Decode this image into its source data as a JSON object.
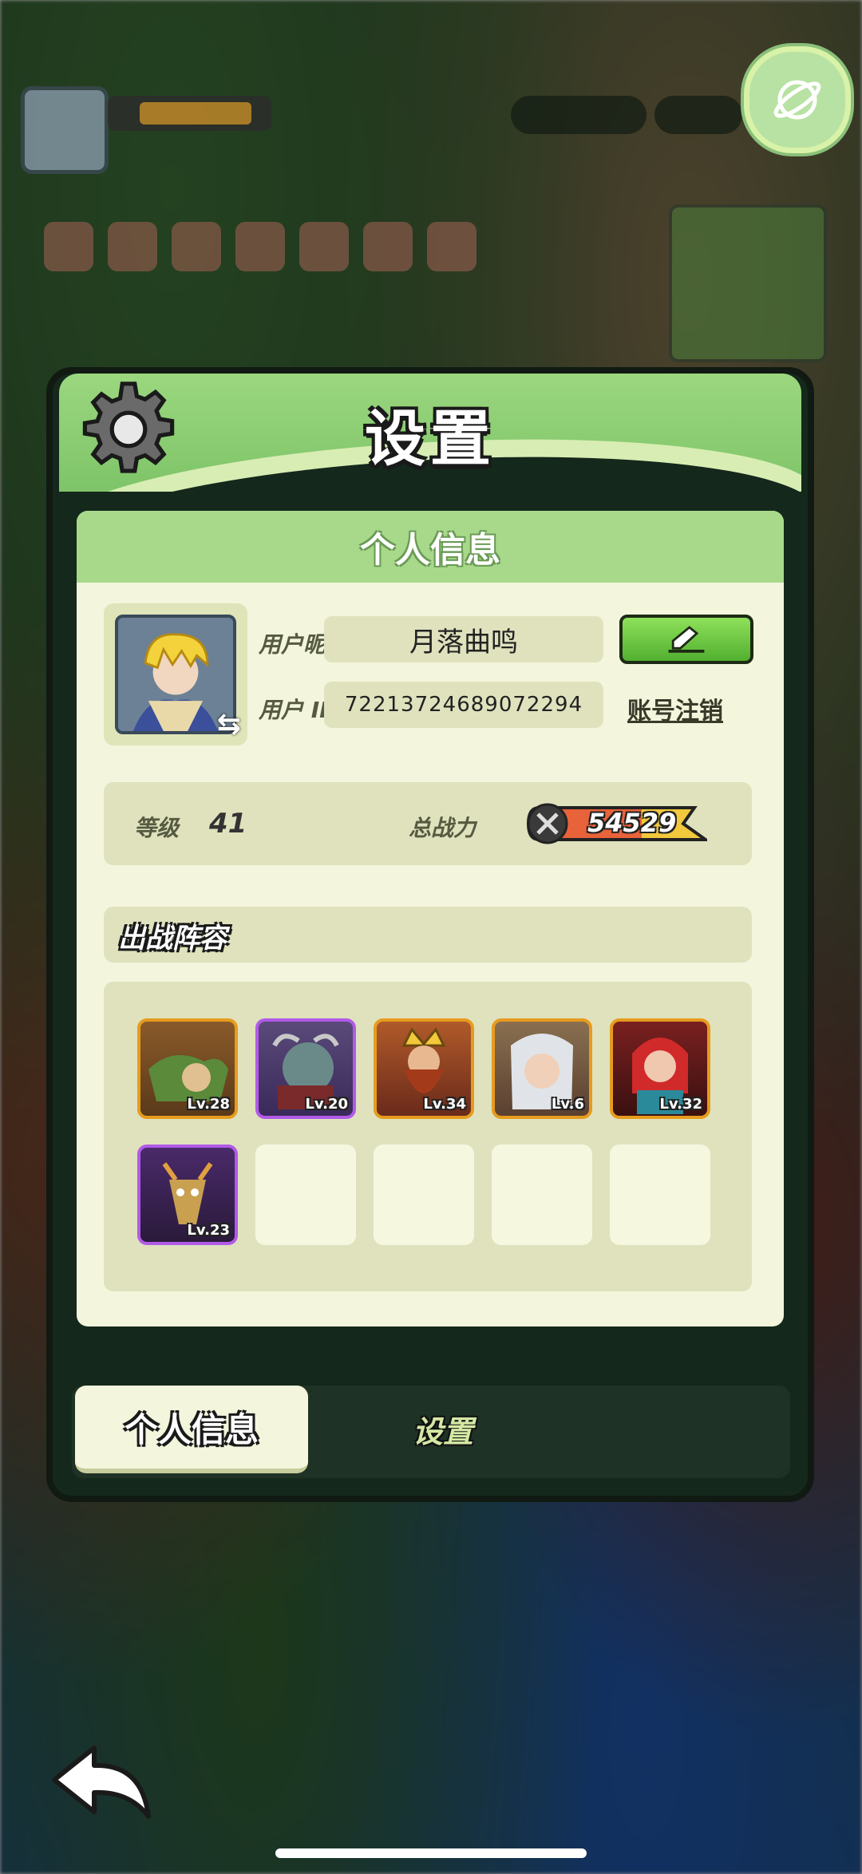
{
  "window": {
    "title": "设置"
  },
  "panel": {
    "header": "个人信息"
  },
  "profile": {
    "nickname_label": "用户昵称",
    "nickname": "月落曲鸣",
    "id_label": "用户 ID",
    "user_id": "72213724689072294",
    "delete_account_link": "账号注销",
    "edit_icon": "pencil-icon",
    "swap_icon": "swap-icon"
  },
  "stats": {
    "level_label": "等级",
    "level": "41",
    "power_label": "总战力",
    "power": "54529"
  },
  "lineup": {
    "title": "出战阵容",
    "heroes": [
      {
        "name": "crocodile-hero",
        "level": "Lv.28",
        "rarity": "gold"
      },
      {
        "name": "beast-warrior-hero",
        "level": "Lv.20",
        "rarity": "purple"
      },
      {
        "name": "king-dwarf-hero",
        "level": "Lv.34",
        "rarity": "gold"
      },
      {
        "name": "white-hair-hero",
        "level": "Lv.6",
        "rarity": "gold"
      },
      {
        "name": "red-hair-hero",
        "level": "Lv.32",
        "rarity": "gold"
      },
      {
        "name": "horned-demon-hero",
        "level": "Lv.23",
        "rarity": "purple"
      }
    ],
    "empty_slots": 4
  },
  "tabs": [
    {
      "label": "个人信息",
      "active": true
    },
    {
      "label": "设置",
      "active": false
    }
  ],
  "colors": {
    "header_green": "#9bd77f",
    "panel_bg": "#f3f6dc",
    "gold_border": "#e79b1e",
    "purple_border": "#b15ae8",
    "edit_button": "#52b030"
  }
}
